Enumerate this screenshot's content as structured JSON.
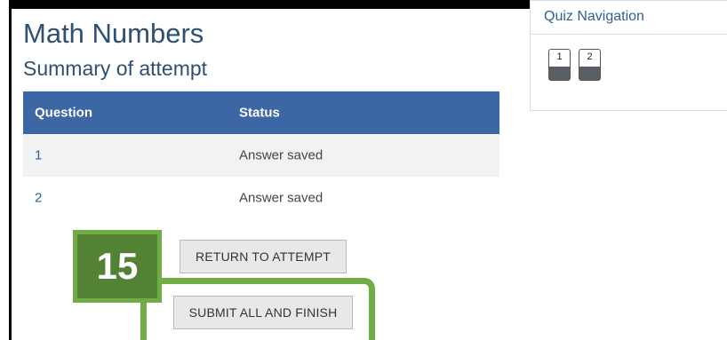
{
  "page": {
    "title": "Math Numbers",
    "subtitle": "Summary of attempt"
  },
  "table": {
    "headers": {
      "question": "Question",
      "status": "Status"
    },
    "rows": [
      {
        "question": "1",
        "status": "Answer saved"
      },
      {
        "question": "2",
        "status": "Answer saved"
      }
    ]
  },
  "buttons": {
    "return_label": "RETURN TO ATTEMPT",
    "submit_label": "SUBMIT ALL AND FINISH"
  },
  "annotation": {
    "step_number": "15",
    "color": "#70ad47"
  },
  "quiz_navigation": {
    "title": "Quiz Navigation",
    "buttons": [
      "1",
      "2"
    ]
  },
  "colors": {
    "header_bg": "#3d66a4",
    "title_text": "#2f4f72",
    "link_text": "#2f5f96"
  }
}
